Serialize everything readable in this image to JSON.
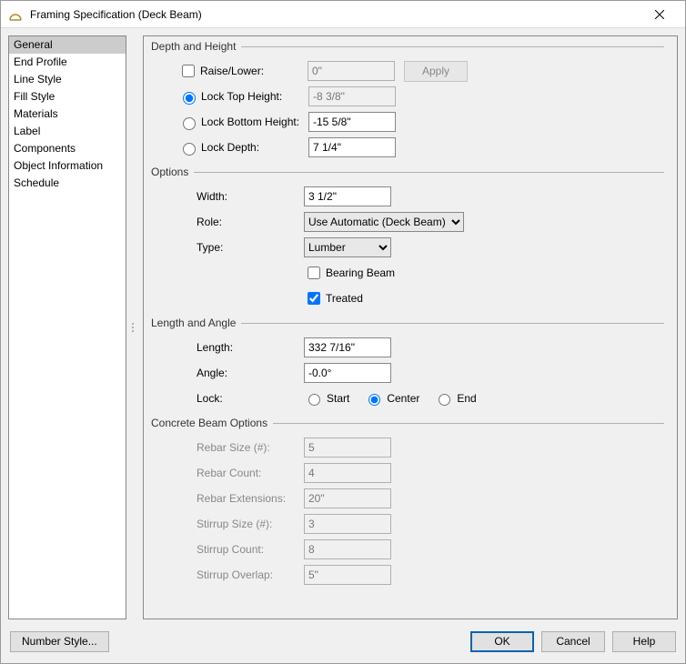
{
  "window": {
    "title": "Framing Specification (Deck Beam)"
  },
  "sidebar": {
    "items": [
      {
        "label": "General",
        "selected": true
      },
      {
        "label": "End Profile"
      },
      {
        "label": "Line Style"
      },
      {
        "label": "Fill Style"
      },
      {
        "label": "Materials"
      },
      {
        "label": "Label"
      },
      {
        "label": "Components"
      },
      {
        "label": "Object Information"
      },
      {
        "label": "Schedule"
      }
    ]
  },
  "groups": {
    "depth": {
      "title": "Depth and Height",
      "raise_lower_label": "Raise/Lower:",
      "raise_lower_value": "0\"",
      "apply_label": "Apply",
      "lock_top_label": "Lock Top Height:",
      "lock_top_value": "-8 3/8\"",
      "lock_bottom_label": "Lock Bottom Height:",
      "lock_bottom_value": "-15 5/8\"",
      "lock_depth_label": "Lock Depth:",
      "lock_depth_value": "7 1/4\""
    },
    "options": {
      "title": "Options",
      "width_label": "Width:",
      "width_value": "3 1/2\"",
      "role_label": "Role:",
      "role_value": "Use Automatic (Deck Beam)",
      "type_label": "Type:",
      "type_value": "Lumber",
      "bearing_label": "Bearing Beam",
      "treated_label": "Treated"
    },
    "length": {
      "title": "Length and Angle",
      "length_label": "Length:",
      "length_value": "332 7/16\"",
      "angle_label": "Angle:",
      "angle_value": "-0.0°",
      "lock_label": "Lock:",
      "lock_start": "Start",
      "lock_center": "Center",
      "lock_end": "End"
    },
    "concrete": {
      "title": "Concrete Beam Options",
      "rebar_size_label": "Rebar Size (#):",
      "rebar_size_value": "5",
      "rebar_count_label": "Rebar Count:",
      "rebar_count_value": "4",
      "rebar_ext_label": "Rebar Extensions:",
      "rebar_ext_value": "20\"",
      "stirrup_size_label": "Stirrup Size (#):",
      "stirrup_size_value": "3",
      "stirrup_count_label": "Stirrup Count:",
      "stirrup_count_value": "8",
      "stirrup_overlap_label": "Stirrup Overlap:",
      "stirrup_overlap_value": "5\""
    }
  },
  "footer": {
    "number_style": "Number Style...",
    "ok": "OK",
    "cancel": "Cancel",
    "help": "Help"
  }
}
